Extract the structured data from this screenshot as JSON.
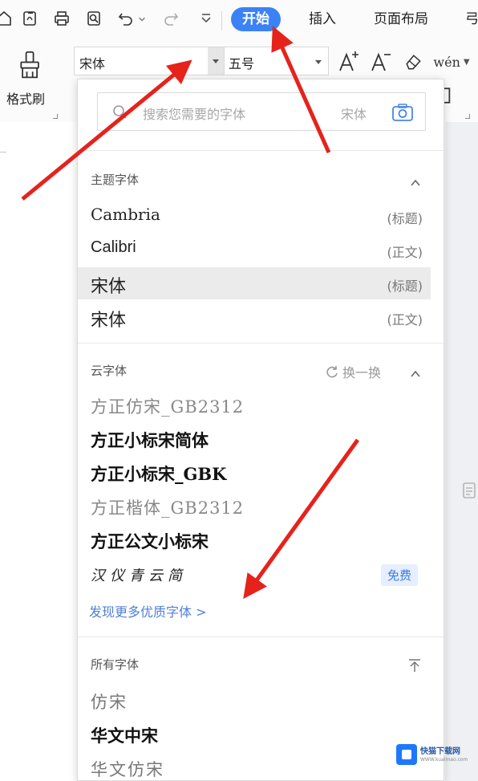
{
  "ribbon": {
    "tabs": [
      {
        "label": "开始",
        "active": true
      },
      {
        "label": "插入",
        "active": false
      },
      {
        "label": "页面布局",
        "active": false
      },
      {
        "label": "弓",
        "active": false
      }
    ],
    "quick_access_icons": [
      "home-icon",
      "export-pdf-icon",
      "print-icon",
      "print-preview-icon",
      "undo-icon",
      "dropdown-chevron-icon",
      "redo-icon",
      "customize-icon"
    ],
    "format_painter_label": "格式刷",
    "font_name_value": "宋体",
    "font_size_value": "五号",
    "pinyin_label": "wén"
  },
  "font_panel": {
    "search_placeholder": "搜索您需要的字体",
    "search_current_font": "宋体",
    "theme_section": {
      "title": "主题字体",
      "rows": [
        {
          "name": "Cambria",
          "tag": "(标题)"
        },
        {
          "name": "Calibri",
          "tag": "(正文)"
        },
        {
          "name": "宋体",
          "tag": "(标题)",
          "selected": true
        },
        {
          "name": "宋体",
          "tag": "(正文)"
        }
      ]
    },
    "cloud_section": {
      "title": "云字体",
      "refresh_label": "换一换",
      "fonts": [
        "方正仿宋_GB2312",
        "方正小标宋简体",
        "方正小标宋_GBK",
        "方正楷体_GB2312",
        "方正公文小标宋",
        "汉仪青云简"
      ],
      "free_badge": "免费",
      "more_link": "发现更多优质字体 >"
    },
    "all_section": {
      "title": "所有字体",
      "fonts": [
        "仿宋",
        "华文中宋",
        "华文仿宋"
      ]
    }
  },
  "watermark": {
    "title": "快猫下载网",
    "subtitle": "WWW.kuaimao.com"
  },
  "colors": {
    "accent": "#3b82f6",
    "arrow": "#e5231b",
    "link": "#4f7fd8"
  }
}
